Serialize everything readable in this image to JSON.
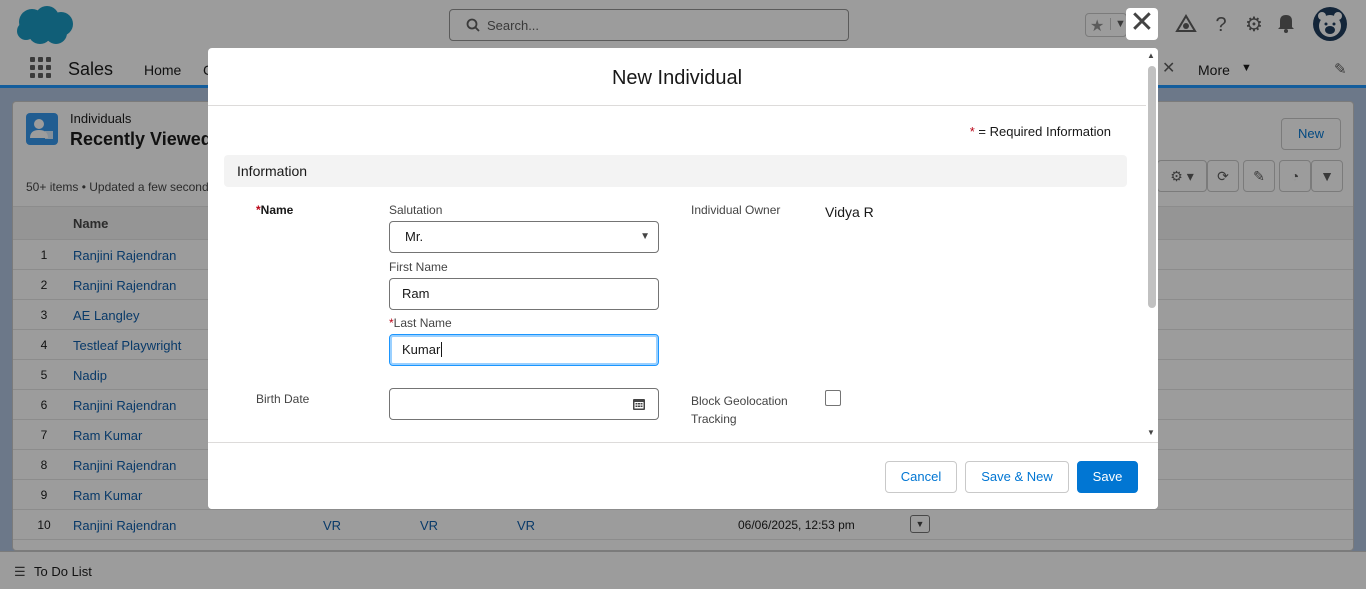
{
  "header": {
    "search_placeholder": "Search...",
    "icons": [
      "star-icon",
      "chevron-down-icon",
      "add-icon",
      "trailhead-icon",
      "help-icon",
      "setup-gear-icon",
      "notification-bell-icon",
      "avatar"
    ]
  },
  "nav": {
    "app_name": "Sales",
    "items": [
      "Home",
      "C"
    ],
    "more_label": "More"
  },
  "list": {
    "object_label": "Individuals",
    "title": "Recently Viewed",
    "meta": "50+ items • Updated a few second",
    "new_button": "New",
    "column_name": "Name",
    "rows": [
      {
        "num": "1",
        "name": "Ranjini Rajendran",
        "c1": "",
        "c2": "",
        "c3": "",
        "date": ""
      },
      {
        "num": "2",
        "name": "Ranjini Rajendran",
        "c1": "",
        "c2": "",
        "c3": "",
        "date": ""
      },
      {
        "num": "3",
        "name": "AE Langley",
        "c1": "",
        "c2": "",
        "c3": "",
        "date": ""
      },
      {
        "num": "4",
        "name": "Testleaf Playwright",
        "c1": "",
        "c2": "",
        "c3": "",
        "date": ""
      },
      {
        "num": "5",
        "name": "Nadip",
        "c1": "",
        "c2": "",
        "c3": "",
        "date": ""
      },
      {
        "num": "6",
        "name": "Ranjini Rajendran",
        "c1": "",
        "c2": "",
        "c3": "",
        "date": ""
      },
      {
        "num": "7",
        "name": "Ram Kumar",
        "c1": "",
        "c2": "",
        "c3": "",
        "date": ""
      },
      {
        "num": "8",
        "name": "Ranjini Rajendran",
        "c1": "",
        "c2": "",
        "c3": "",
        "date": ""
      },
      {
        "num": "9",
        "name": "Ram Kumar",
        "c1": "",
        "c2": "",
        "c3": "",
        "date": ""
      },
      {
        "num": "10",
        "name": "Ranjini Rajendran",
        "c1": "VR",
        "c2": "VR",
        "c3": "VR",
        "date": "06/06/2025, 12:53 pm"
      }
    ]
  },
  "footer": {
    "todo_label": "To Do List"
  },
  "modal": {
    "title": "New Individual",
    "required_info": "= Required Information",
    "section_title": "Information",
    "name_label": "Name",
    "salutation_label": "Salutation",
    "salutation_value": "Mr.",
    "first_name_label": "First Name",
    "first_name_value": "Ram",
    "last_name_label": "Last Name",
    "last_name_value": "Kumar",
    "birth_date_label": "Birth Date",
    "birth_date_value": "",
    "owner_label": "Individual Owner",
    "owner_value": "Vidya R",
    "geo_label_line1": "Block Geolocation",
    "geo_label_line2": "Tracking",
    "buttons": {
      "cancel": "Cancel",
      "save_new": "Save & New",
      "save": "Save"
    }
  },
  "colors": {
    "brand": "#0176d3",
    "link": "#0b5cab",
    "required": "#ba0517",
    "focus": "#1b96ff"
  }
}
